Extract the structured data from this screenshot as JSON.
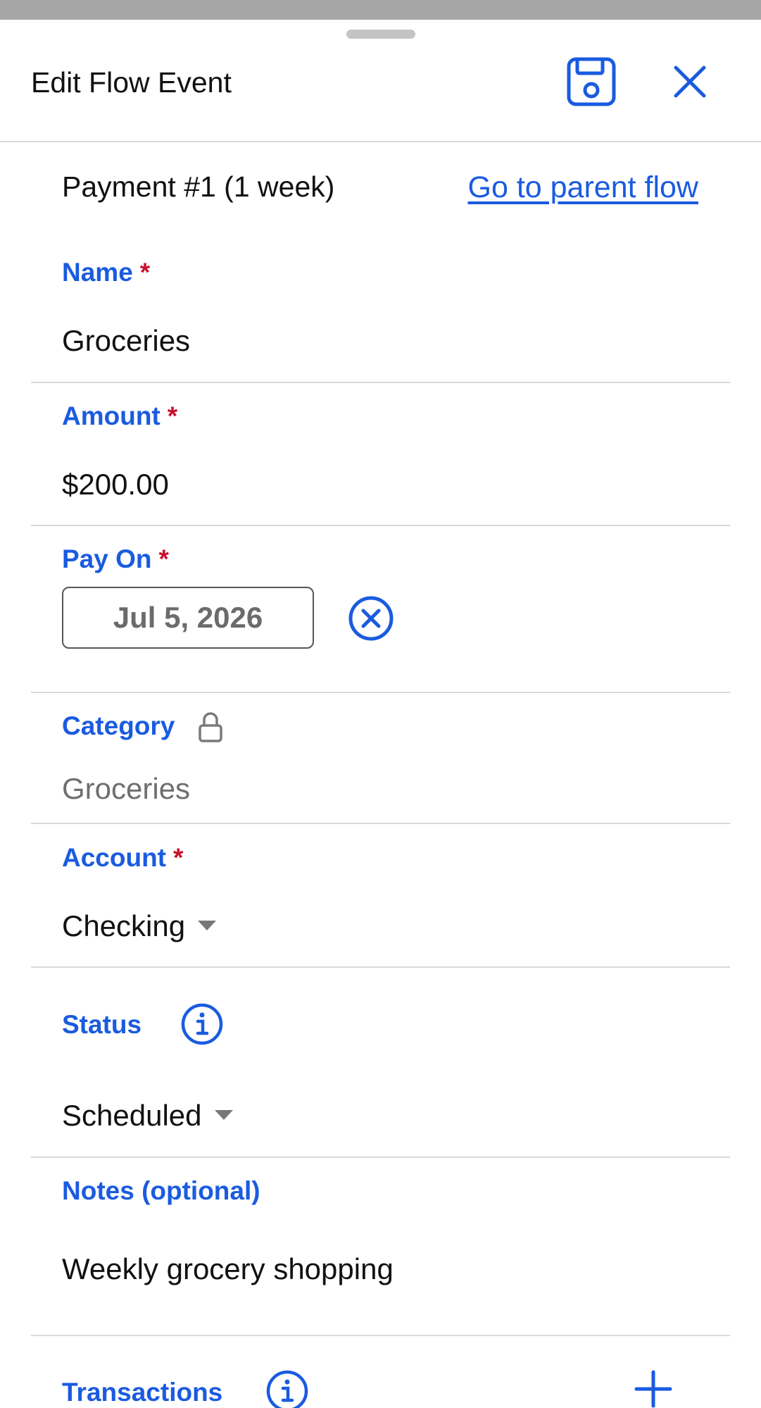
{
  "header": {
    "title": "Edit Flow Event",
    "save_icon": "floppy-disk-icon",
    "close_icon": "close-icon"
  },
  "event": {
    "subtitle": "Payment #1 (1 week)",
    "parent_link": "Go to parent flow"
  },
  "fields": {
    "name": {
      "label": "Name",
      "required_mark": "*",
      "value": "Groceries"
    },
    "amount": {
      "label": "Amount",
      "required_mark": "*",
      "value": "$200.00"
    },
    "pay_on": {
      "label": "Pay On",
      "required_mark": "*",
      "value": "Jul 5, 2026",
      "clear_icon": "clear-circle-icon"
    },
    "category": {
      "label": "Category",
      "value": "Groceries",
      "lock_icon": "lock-icon"
    },
    "account": {
      "label": "Account",
      "required_mark": "*",
      "value": "Checking"
    },
    "status": {
      "label": "Status",
      "value": "Scheduled",
      "info_icon": "info-icon"
    },
    "notes": {
      "label": "Notes (optional)",
      "value": "Weekly grocery shopping"
    },
    "transactions": {
      "label": "Transactions",
      "info_icon": "info-icon",
      "add_icon": "plus-icon"
    }
  },
  "colors": {
    "accent": "#1a5be0",
    "required": "#c8102e",
    "divider": "#d9d9d9",
    "muted_text": "#6f6f6f"
  }
}
